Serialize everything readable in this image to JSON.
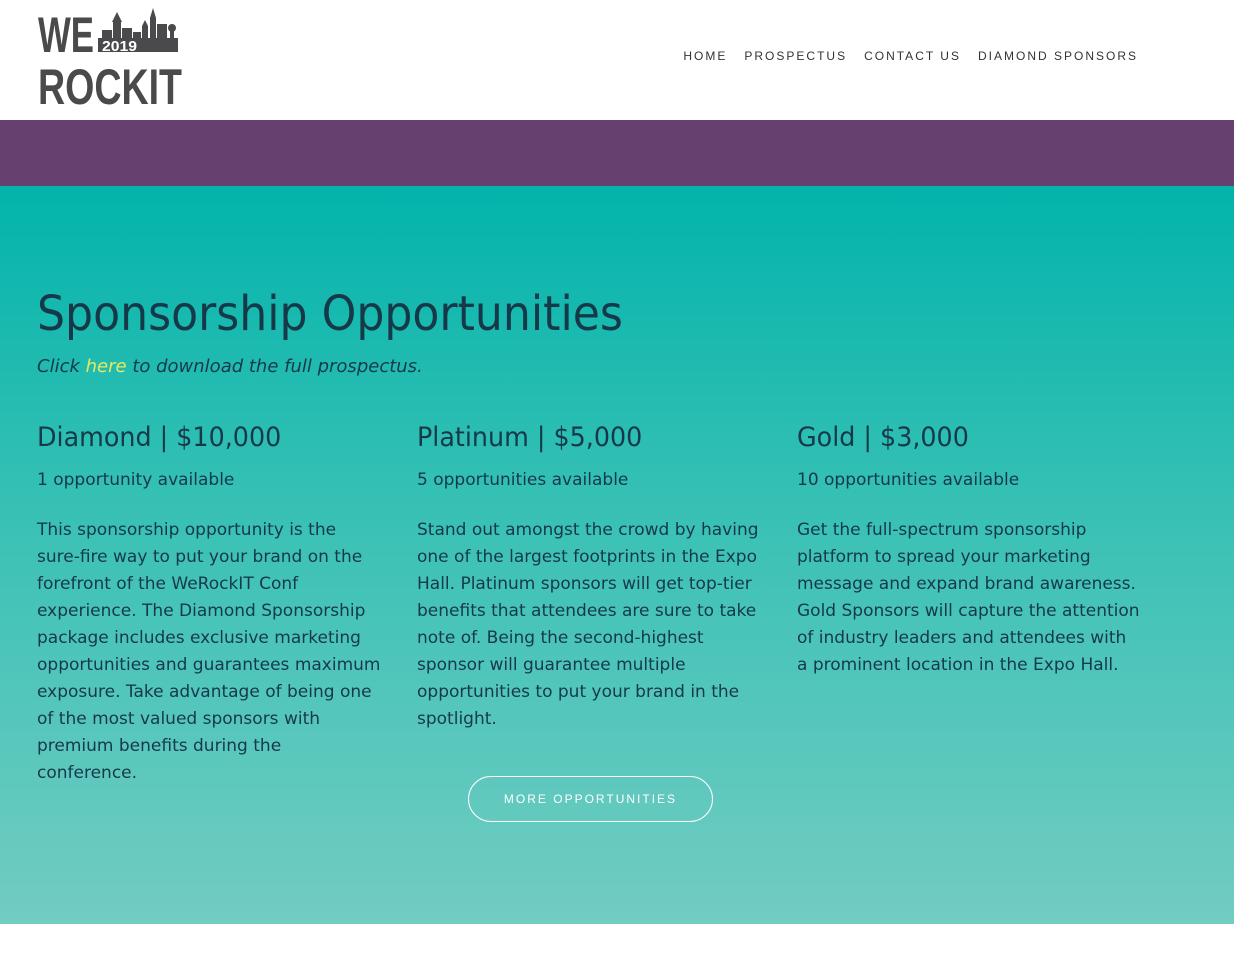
{
  "logo": {
    "line1": "WE",
    "year": "2019",
    "line2": "ROCKIT",
    "color": "#4a4a4c"
  },
  "nav": {
    "items": [
      {
        "label": "HOME"
      },
      {
        "label": "PROSPECTUS"
      },
      {
        "label": "CONTACT US"
      },
      {
        "label": "DIAMOND SPONSORS"
      }
    ]
  },
  "colors": {
    "purple_bar": "#66406e",
    "teal_top": "#02b4ab",
    "teal_bottom": "#72ccc2",
    "heading_text": "#16394a",
    "link": "#e8e85c"
  },
  "hero": {
    "title": "Sponsorship Opportunities",
    "download_prefix": "Click ",
    "download_link": "here",
    "download_suffix": " to download the full prospectus.",
    "tiers": [
      {
        "heading": "Diamond | $10,000",
        "availability": "1 opportunity available",
        "description": "This sponsorship opportunity is the sure-fire way to put your brand on the forefront of the WeRockIT Conf experience. The Diamond Sponsorship package includes exclusive marketing opportunities and guarantees maximum exposure. Take advantage of being one of the most valued sponsors with premium benefits during the conference."
      },
      {
        "heading": "Platinum | $5,000",
        "availability": "5 opportunities available",
        "description": "Stand out amongst the crowd by having one of the largest footprints in the Expo Hall. Platinum sponsors will get top-tier benefits that attendees are sure to take note of. Being the second-highest sponsor will guarantee multiple opportunities to put your brand in the spotlight."
      },
      {
        "heading": "Gold | $3,000",
        "availability": "10 opportunities available",
        "description": "Get the full-spectrum sponsorship platform to spread your marketing message and expand brand awareness. Gold Sponsors will capture the attention of industry leaders and attendees with a prominent location in the Expo Hall."
      }
    ],
    "more_button": "MORE OPPORTUNITIES"
  }
}
